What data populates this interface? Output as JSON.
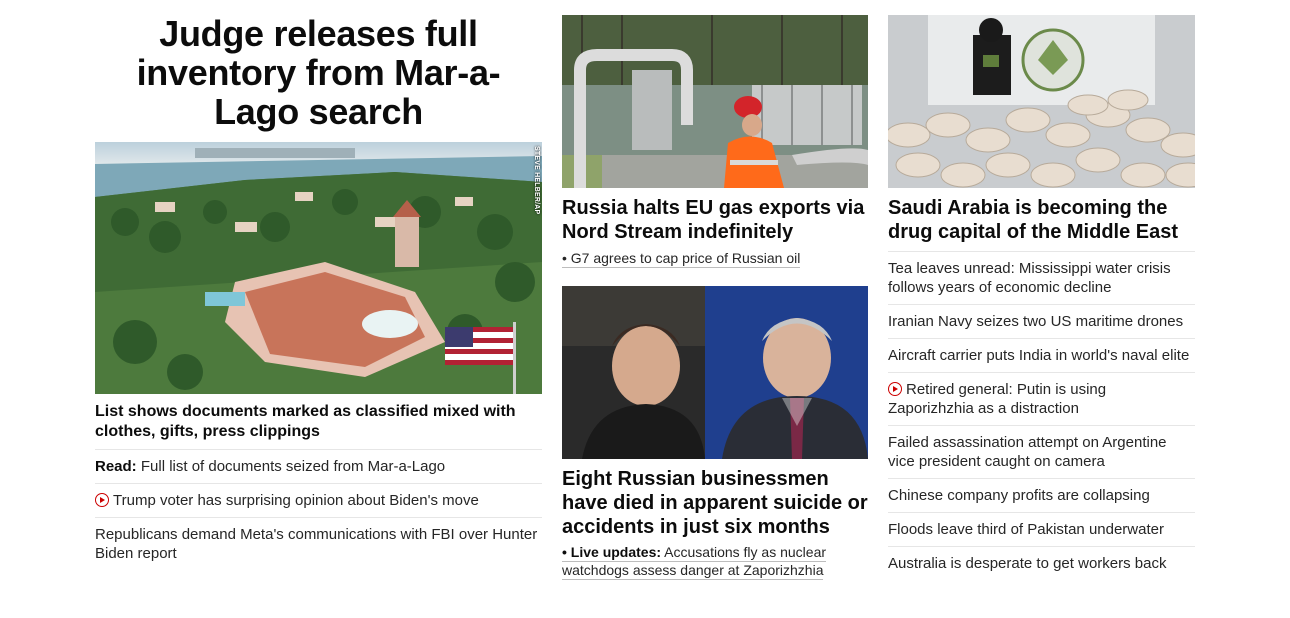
{
  "lead": {
    "banner_headline": "Judge releases full inventory from Mar-a-Lago search",
    "image_credit": "STEVE HELBER/AP",
    "image_alt": "Aerial view of Mar-a-Lago estate",
    "sub_headline": "List shows documents marked as classified mixed with clothes, gifts, press clippings",
    "links": [
      {
        "prefix": "Read:",
        "text": "Full list of documents seized from Mar-a-Lago",
        "video": false
      },
      {
        "prefix": "",
        "text": "Trump voter has surprising opinion about Biden's move",
        "video": true
      },
      {
        "prefix": "",
        "text": "Republicans demand Meta's communications with FBI over Hunter Biden report",
        "video": false
      }
    ]
  },
  "middle": {
    "story1": {
      "headline": "Russia halts EU gas exports via Nord Stream indefinitely",
      "bullet": "• G7 agrees to cap price of Russian oil"
    },
    "story2": {
      "headline": "Eight Russian businessmen have died in apparent suicide or accidents in just six months",
      "bullet_label": "• Live updates:",
      "bullet_text": "Accusations fly as nuclear watchdogs assess danger at Zaporizhzhia"
    }
  },
  "right": {
    "headline": "Saudi Arabia is becoming the drug capital of the Middle East",
    "links": [
      {
        "text": "Tea leaves unread: Mississippi water crisis follows years of economic decline",
        "video": false
      },
      {
        "text": "Iranian Navy seizes two US maritime drones",
        "video": false
      },
      {
        "text": "Aircraft carrier puts India in world's naval elite",
        "video": false
      },
      {
        "text": "Retired general: Putin is using Zaporizhzhia as a distraction",
        "video": true
      },
      {
        "text": "Failed assassination attempt on Argentine vice president caught on camera",
        "video": false
      },
      {
        "text": "Chinese company profits are collapsing",
        "video": false
      },
      {
        "text": "Floods leave third of Pakistan underwater",
        "video": false
      },
      {
        "text": "Australia is desperate to get workers back",
        "video": false
      }
    ]
  },
  "colors": {
    "accent": "#cc0000",
    "text": "#0c0c0c",
    "divider": "#e6e6e6"
  }
}
